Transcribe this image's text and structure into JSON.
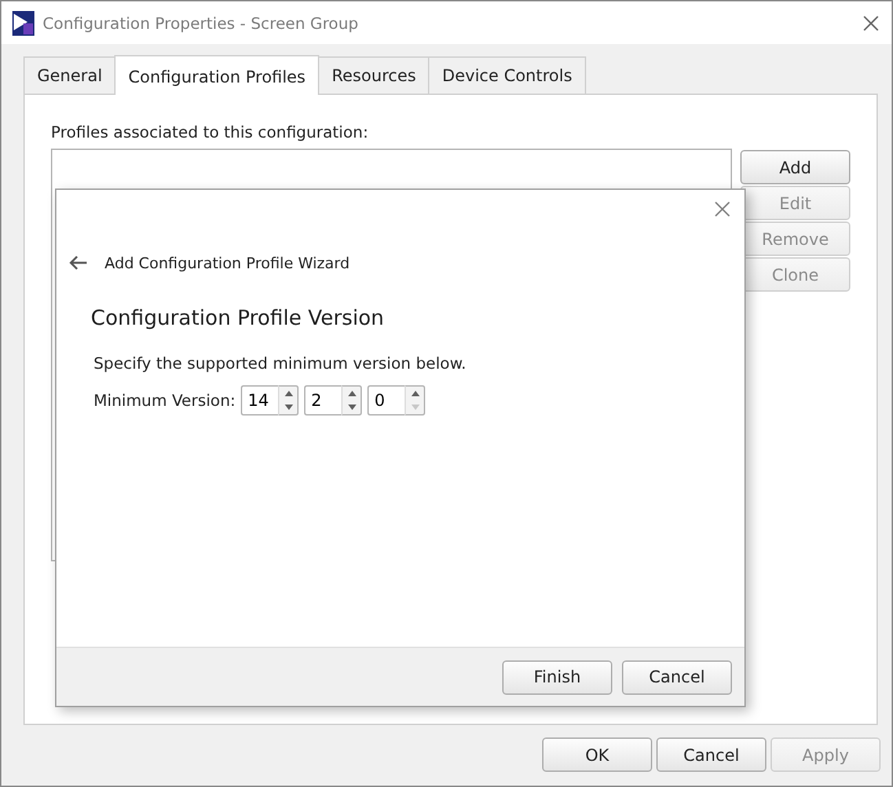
{
  "window": {
    "title": "Configuration Properties - Screen Group"
  },
  "tabs": [
    {
      "label": "General",
      "selected": false
    },
    {
      "label": "Configuration Profiles",
      "selected": true
    },
    {
      "label": "Resources",
      "selected": false
    },
    {
      "label": "Device Controls",
      "selected": false
    }
  ],
  "profiles": {
    "label": "Profiles associated to this configuration:",
    "buttons": [
      {
        "label": "Add",
        "disabled": false
      },
      {
        "label": "Edit",
        "disabled": true
      },
      {
        "label": "Remove",
        "disabled": true
      },
      {
        "label": "Clone",
        "disabled": true
      }
    ]
  },
  "wizard": {
    "title": "Add Configuration Profile Wizard",
    "heading": "Configuration Profile Version",
    "instruction": "Specify the supported minimum version below.",
    "version_label": "Minimum Version:",
    "version_parts": [
      {
        "value": "14",
        "down_disabled": false
      },
      {
        "value": "2",
        "down_disabled": false
      },
      {
        "value": "0",
        "down_disabled": true
      }
    ],
    "buttons": [
      {
        "label": "Finish",
        "disabled": false
      },
      {
        "label": "Cancel",
        "disabled": false
      }
    ]
  },
  "buttons": [
    {
      "label": "OK",
      "disabled": false
    },
    {
      "label": "Cancel",
      "disabled": false
    },
    {
      "label": "Apply",
      "disabled": true
    }
  ]
}
